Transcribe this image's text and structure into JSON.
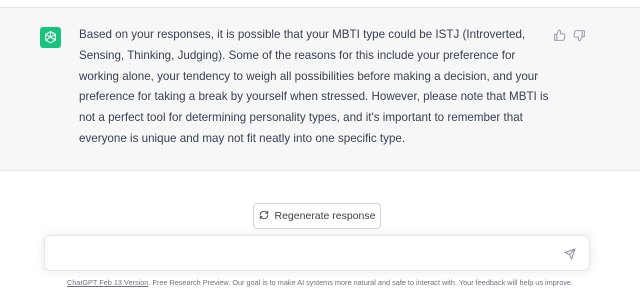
{
  "message": {
    "avatar_icon": "openai-logo-icon",
    "text": "Based on your responses, it is possible that your MBTI type could be ISTJ (Introverted, Sensing, Thinking, Judging). Some of the reasons for this include your preference for working alone, your tendency to weigh all possibilities before making a decision, and your preference for taking a break by yourself when stressed. However, please note that MBTI is not a perfect tool for determining personality types, and it's important to remember that everyone is unique and may not fit neatly into one specific type.",
    "thumbs_up_icon": "thumbs-up-icon",
    "thumbs_down_icon": "thumbs-down-icon"
  },
  "regenerate": {
    "icon": "refresh-icon",
    "label": "Regenerate response"
  },
  "composer": {
    "value": "",
    "send_icon": "send-icon"
  },
  "footer": {
    "version_link": "ChatGPT Feb 13 Version",
    "text": ". Free Research Preview. Our goal is to make AI systems more natural and safe to interact with. Your feedback will help us improve."
  },
  "colors": {
    "accent": "#19c37d",
    "message_bg": "#f7f7f8",
    "text": "#374151"
  }
}
